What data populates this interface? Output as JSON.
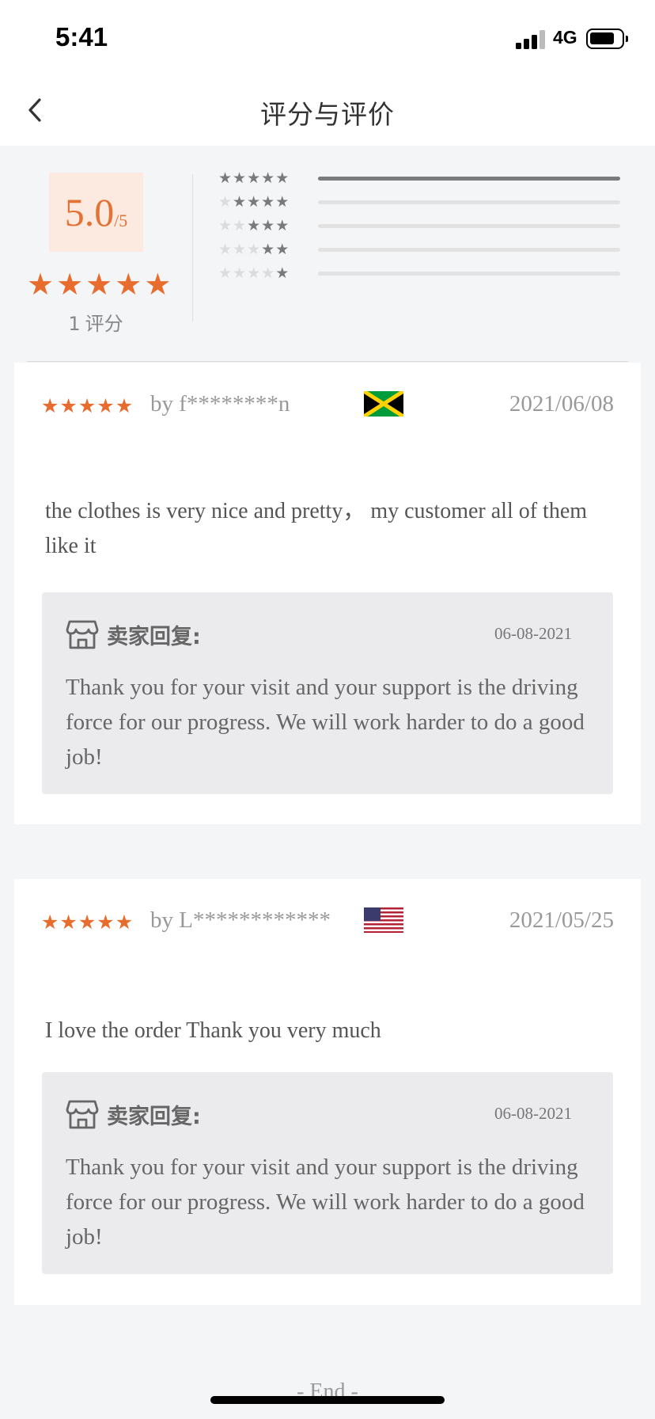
{
  "status_bar": {
    "time": "5:41",
    "network": "4G"
  },
  "header": {
    "title": "评分与评价",
    "back_icon": "chevron-left-icon"
  },
  "summary": {
    "score": "5.0",
    "score_suffix": "/5",
    "average_stars": 5,
    "rating_count": "1",
    "rating_count_label": "评分",
    "distribution": [
      {
        "stars": 5,
        "fraction": 1.0
      },
      {
        "stars": 4,
        "fraction": 0
      },
      {
        "stars": 3,
        "fraction": 0
      },
      {
        "stars": 2,
        "fraction": 0
      },
      {
        "stars": 1,
        "fraction": 0
      }
    ]
  },
  "reviews": [
    {
      "stars": 5,
      "reviewer": "by f********n",
      "flag": "jamaica-flag",
      "date": "2021/06/08",
      "text": "the clothes is very nice and pretty， my customer all of them like it",
      "reply": {
        "label": "卖家回复:",
        "date": "06-08-2021",
        "text": "Thank you for your visit and your support is the driving force for our progress. We will work harder to do a good job!"
      }
    },
    {
      "stars": 5,
      "reviewer": "by L************",
      "flag": "usa-flag",
      "date": "2021/05/25",
      "text": "I love the order Thank you very much",
      "reply": {
        "label": "卖家回复:",
        "date": "06-08-2021",
        "text": "Thank you for your visit and your support is the driving force for our progress. We will work harder to do a good job!"
      }
    }
  ],
  "footer": {
    "end_text": "- End -"
  },
  "colors": {
    "accent": "#e96c2f",
    "score_bg": "#fce9df",
    "reply_bg": "#ebebed",
    "page_bg": "#f4f5f7"
  }
}
